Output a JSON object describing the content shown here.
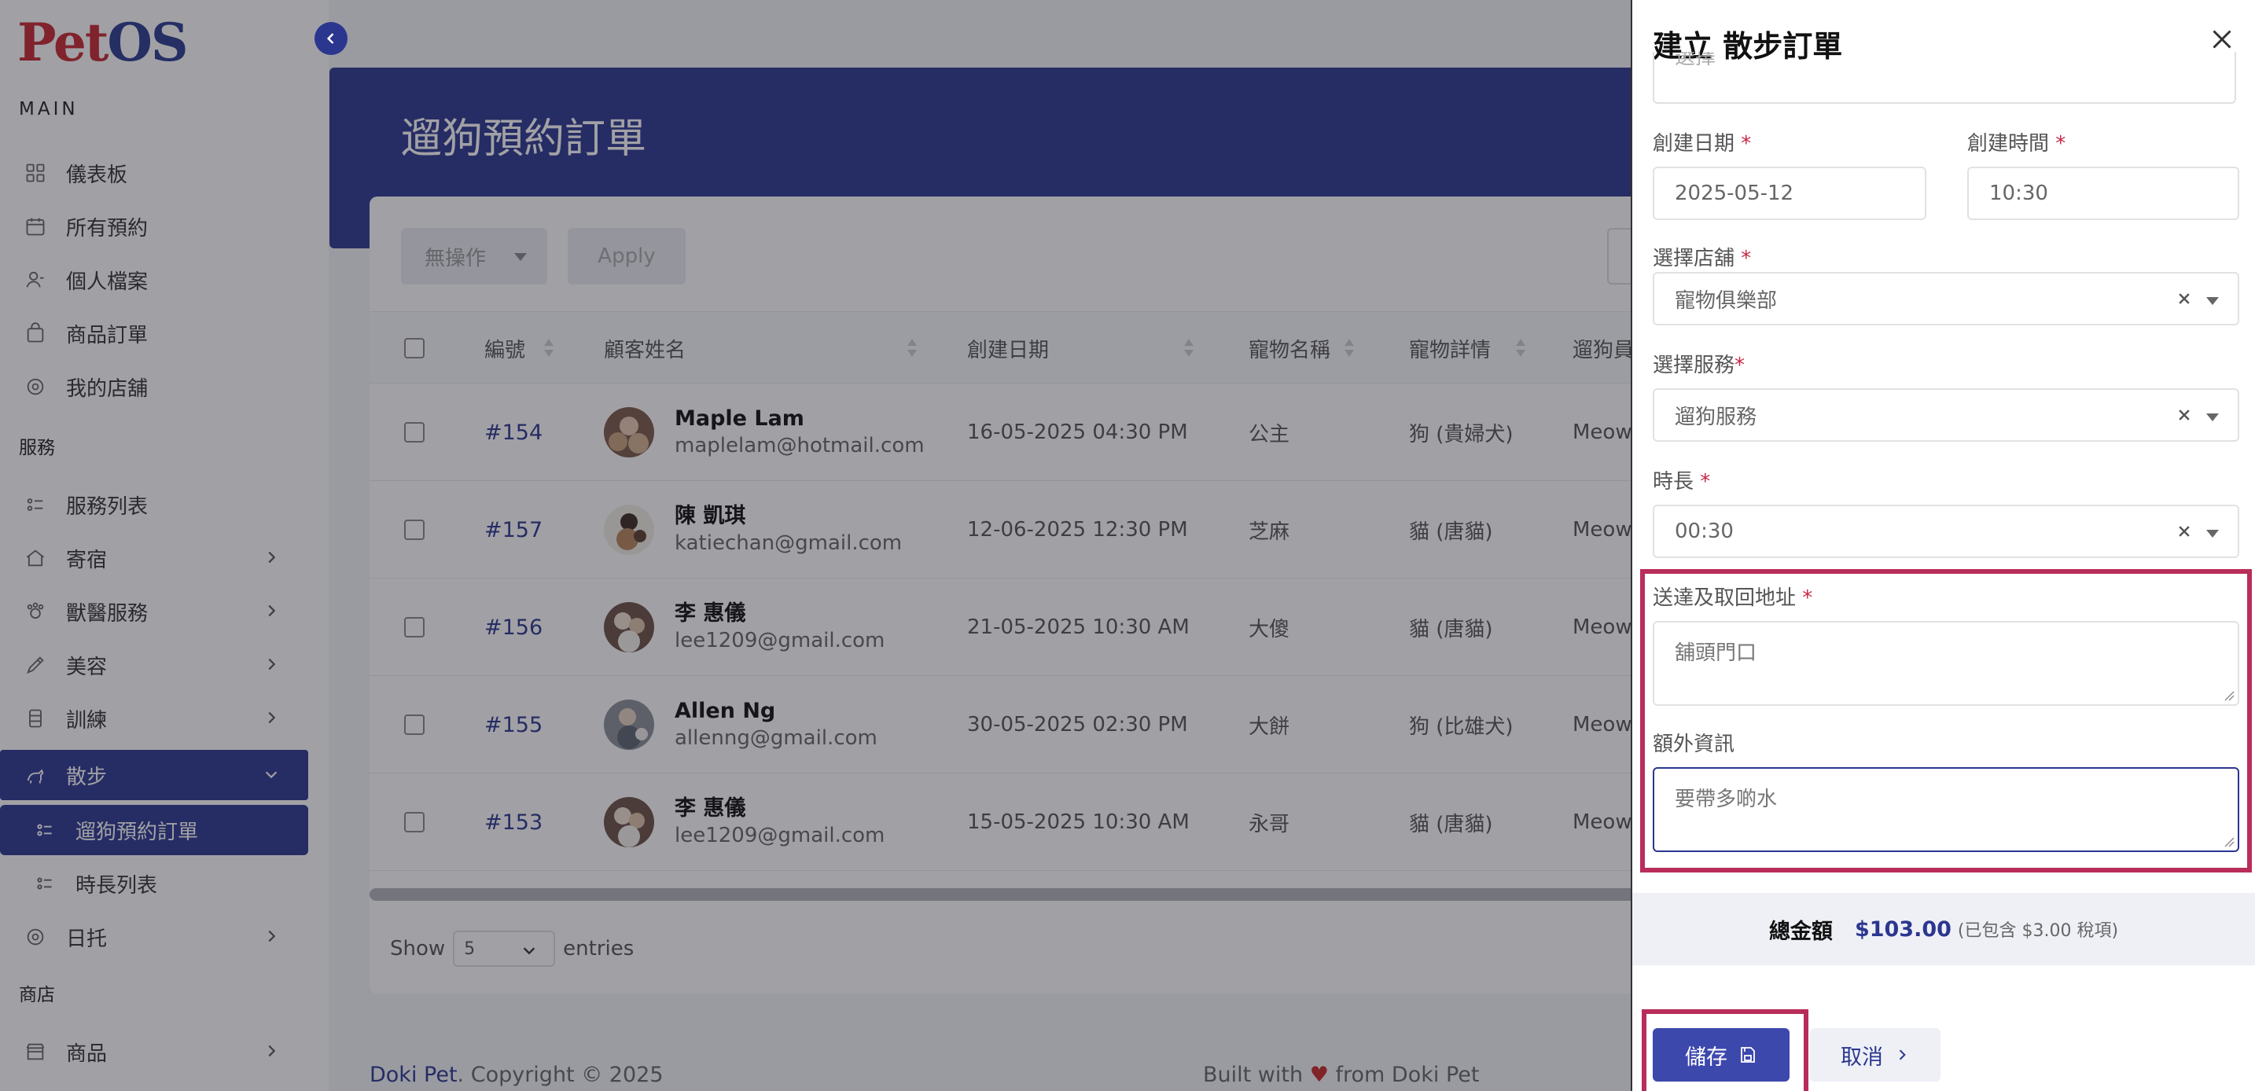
{
  "logo": {
    "part1": "Pet",
    "part2": "OS"
  },
  "sidebar": {
    "section_main": "MAIN",
    "section_services": "服務",
    "section_store": "商店",
    "items": [
      {
        "label": "儀表板",
        "icon": "grid-icon"
      },
      {
        "label": "所有預約",
        "icon": "calendar-icon"
      },
      {
        "label": "個人檔案",
        "icon": "user-icon"
      },
      {
        "label": "商品訂單",
        "icon": "bag-icon"
      },
      {
        "label": "我的店舖",
        "icon": "store-icon"
      },
      {
        "label": "服務列表",
        "icon": "list-icon"
      },
      {
        "label": "寄宿",
        "icon": "house-icon"
      },
      {
        "label": "獸醫服務",
        "icon": "vet-icon"
      },
      {
        "label": "美容",
        "icon": "brush-icon"
      },
      {
        "label": "訓練",
        "icon": "training-icon"
      },
      {
        "label": "散步",
        "icon": "dog-icon"
      },
      {
        "label": "日托",
        "icon": "daycare-icon"
      },
      {
        "label": "商品",
        "icon": "shop-icon"
      }
    ],
    "walk_sub": [
      {
        "label": "遛狗預約訂單"
      },
      {
        "label": "時長列表"
      }
    ]
  },
  "main": {
    "page_title": "遛狗預約訂單",
    "bulk_action": "無操作",
    "apply_label": "Apply",
    "columns": [
      "編號",
      "顧客姓名",
      "創建日期",
      "寵物名稱",
      "寵物詳情",
      "遛狗員"
    ],
    "rows": [
      {
        "id": "#154",
        "name": "Maple Lam",
        "email": "maplelam@hotmail.com",
        "date": "16-05-2025 04:30 PM",
        "pet": "公主",
        "detail": "狗 (貴婦犬)",
        "walker": "Meow"
      },
      {
        "id": "#157",
        "name": "陳 凱琪",
        "email": "katiechan@gmail.com",
        "date": "12-06-2025 12:30 PM",
        "pet": "芝麻",
        "detail": "貓 (唐貓)",
        "walker": "Meow"
      },
      {
        "id": "#156",
        "name": "李 惠儀",
        "email": "lee1209@gmail.com",
        "date": "21-05-2025 10:30 AM",
        "pet": "大傻",
        "detail": "貓 (唐貓)",
        "walker": "Meow"
      },
      {
        "id": "#155",
        "name": "Allen Ng",
        "email": "allenng@gmail.com",
        "date": "30-05-2025 02:30 PM",
        "pet": "大餅",
        "detail": "狗 (比雄犬)",
        "walker": "Meow"
      },
      {
        "id": "#153",
        "name": "李 惠儀",
        "email": "lee1209@gmail.com",
        "date": "15-05-2025 10:30 AM",
        "pet": "永哥",
        "detail": "貓 (唐貓)",
        "walker": "Meow"
      }
    ],
    "show_label": "Show",
    "entries_value": "5",
    "entries_label": "entries"
  },
  "footer": {
    "brand": "Doki Pet",
    "copyright": ". Copyright © 2025",
    "built_with": "Built with",
    "heart": "♥",
    "from": "from Doki Pet"
  },
  "drawer": {
    "title": "建立 散步訂單",
    "cut_value": "選擇",
    "create_date_label": "創建日期",
    "create_date_value": "2025-05-12",
    "create_time_label": "創建時間",
    "create_time_value": "10:30",
    "store_label": "選擇店舖",
    "store_value": "寵物俱樂部",
    "service_label": "選擇服務",
    "service_value": "遛狗服務",
    "duration_label": "時長",
    "duration_value": "00:30",
    "address_label": "送達及取回地址",
    "address_value": "舖頭門口",
    "extra_label": "額外資訊",
    "extra_value": "要帶多啲水",
    "required_mark": "*",
    "total_label": "總金額",
    "total_amount": "$103.00",
    "total_tax": "(已包含 $3.00 稅項)",
    "save_label": "儲存",
    "cancel_label": "取消"
  },
  "colors": {
    "primary": "#2b368f",
    "highlight": "#b82d5a",
    "required": "#c62a47",
    "logo_red": "#c72631"
  }
}
